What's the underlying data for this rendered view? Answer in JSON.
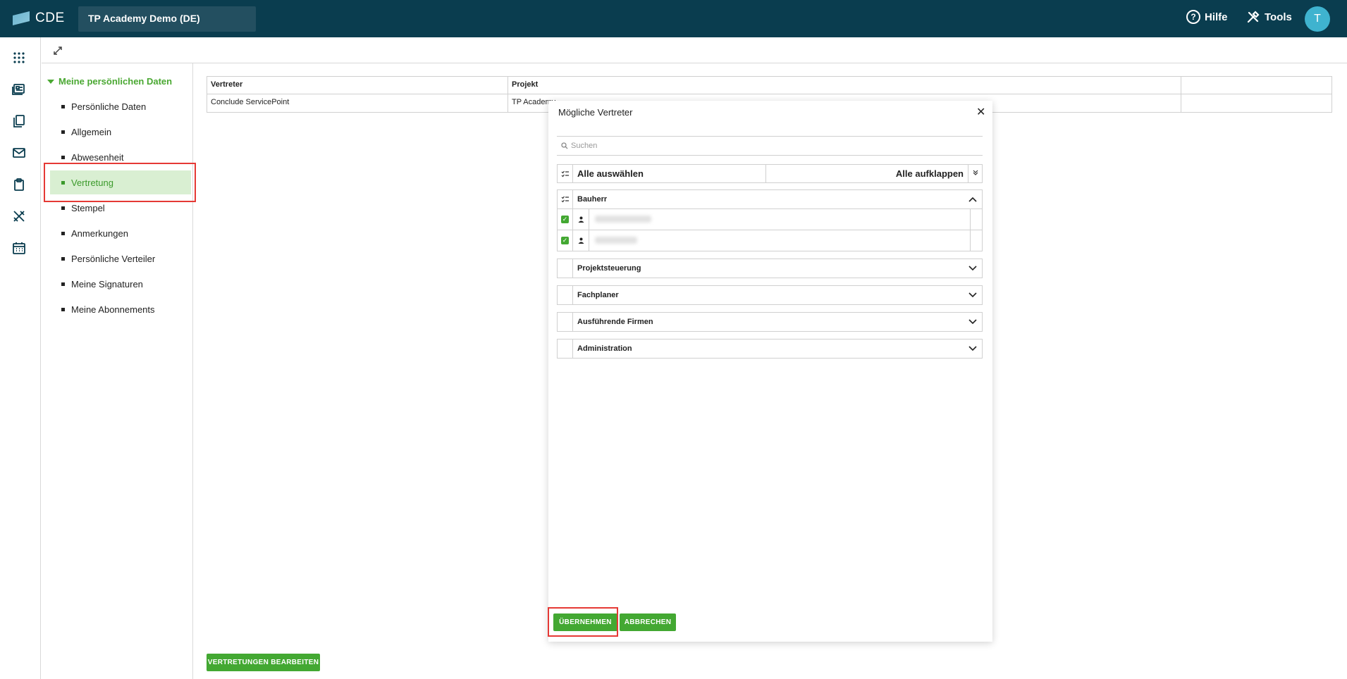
{
  "header": {
    "logo_text": "CDE",
    "project_name": "TP Academy Demo (DE)",
    "help_label": "Hilfe",
    "tools_label": "Tools",
    "avatar_initial": "T"
  },
  "rail": {
    "icons": [
      "apps-grid-icon",
      "dashboard-icon",
      "documents-icon",
      "mail-icon",
      "clipboard-icon",
      "tools-icon",
      "calendar-icon"
    ]
  },
  "nav": {
    "section_title": "Meine persönlichen Daten",
    "items": [
      {
        "label": "Persönliche Daten"
      },
      {
        "label": "Allgemein"
      },
      {
        "label": "Abwesenheit"
      },
      {
        "label": "Vertretung",
        "active": true
      },
      {
        "label": "Stempel"
      },
      {
        "label": "Anmerkungen"
      },
      {
        "label": "Persönliche Verteiler"
      },
      {
        "label": "Meine Signaturen"
      },
      {
        "label": "Meine Abonnements"
      }
    ]
  },
  "table": {
    "headers": [
      "Vertreter",
      "Projekt",
      ""
    ],
    "rows": [
      [
        "Conclude ServicePoint",
        "TP Academy",
        ""
      ]
    ]
  },
  "main": {
    "edit_button": "VERTRETUNGEN BEARBEITEN"
  },
  "modal": {
    "title": "Mögliche Vertreter",
    "search_placeholder": "Suchen",
    "select_all": "Alle auswählen",
    "expand_all": "Alle aufklappen",
    "groups": [
      {
        "name": "Bauherr",
        "expanded": true
      },
      {
        "name": "Projektsteuerung",
        "expanded": false
      },
      {
        "name": "Fachplaner",
        "expanded": false
      },
      {
        "name": "Ausführende Firmen",
        "expanded": false
      },
      {
        "name": "Administration",
        "expanded": false
      }
    ],
    "apply_button": "ÜBERNEHMEN",
    "cancel_button": "ABBRECHEN"
  },
  "colors": {
    "header_bg": "#0a3d4f",
    "accent_green": "#43a832",
    "highlight_red": "#e53935"
  }
}
